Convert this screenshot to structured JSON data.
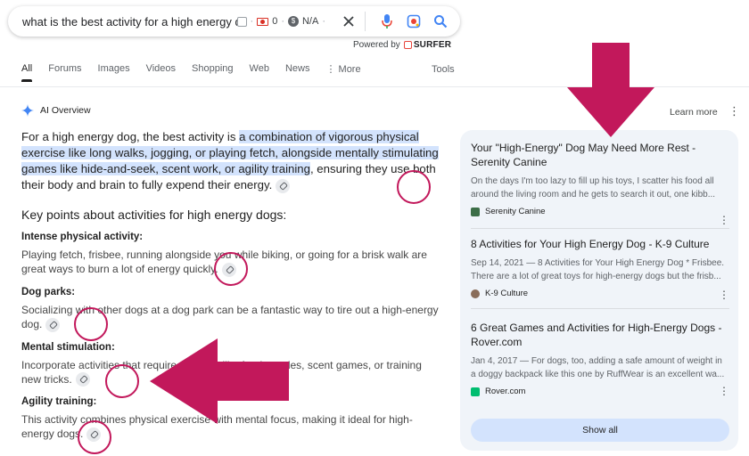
{
  "search": {
    "query": "what is the best activity for a high energy dog",
    "seo_count": "0",
    "seo_value": "N/A",
    "powered_by": "Powered by",
    "surfer": "SURFER"
  },
  "tabs": [
    {
      "label": "All",
      "active": true
    },
    {
      "label": "Forums"
    },
    {
      "label": "Images"
    },
    {
      "label": "Videos"
    },
    {
      "label": "Shopping"
    },
    {
      "label": "Web"
    },
    {
      "label": "News"
    },
    {
      "label": "⋮ More"
    }
  ],
  "tools_label": "Tools",
  "ai_overview": {
    "title": "AI Overview",
    "learn_more": "Learn more",
    "intro_pre": "For a high energy dog, the best activity is ",
    "intro_highlight": "a combination of vigorous physical exercise like long walks, jogging, or playing fetch, alongside mentally stimulating games like hide-and-seek, scent work, or agility training",
    "intro_post": ", ensuring they use both their body and brain to fully expend their energy.",
    "key_points_heading": "Key points about activities for high energy dogs:",
    "sections": [
      {
        "heading": "Intense physical activity:",
        "text": "Playing fetch, frisbee, running alongside you while biking, or going for a brisk walk are great ways to burn a lot of energy quickly."
      },
      {
        "heading": "Dog parks:",
        "text": "Socializing with other dogs at a dog park can be a fantastic way to tire out a high-energy dog."
      },
      {
        "heading": "Mental stimulation:",
        "text": "Incorporate activities that require thinking, like food puzzles, scent games, or training new tricks."
      },
      {
        "heading": "Agility training:",
        "text": "This activity combines physical exercise with mental focus, making it ideal for high-energy dogs."
      }
    ]
  },
  "sources": [
    {
      "title": "Your \"High-Energy\" Dog May Need More Rest - Serenity Canine",
      "snippet": "On the days I'm too lazy to fill up his toys, I scatter his food all around the living room and he gets to search it out, one kibb...",
      "site": "Serenity Canine",
      "favicon_color": "#3c6e47"
    },
    {
      "title": "8 Activities for Your High Energy Dog - K-9 Culture",
      "snippet": "Sep 14, 2021 — 8 Activities for Your High Energy Dog * Frisbee. There are a lot of great toys for high-energy dogs but the frisb...",
      "site": "K-9 Culture",
      "favicon_color": "#8a6d5a"
    },
    {
      "title": "6 Great Games and Activities for High-Energy Dogs - Rover.com",
      "snippet": "Jan 4, 2017 — For dogs, too, adding a safe amount of weight in a doggy backpack like this one by RuffWear is an excellent wa...",
      "site": "Rover.com",
      "favicon_color": "#00bd70"
    }
  ],
  "show_all": "Show all",
  "colors": {
    "accent": "#d3e3fd",
    "annotation": "#c2185b"
  }
}
